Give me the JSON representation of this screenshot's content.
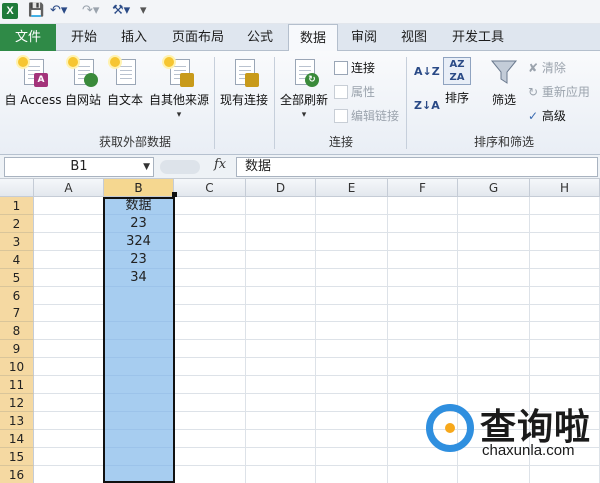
{
  "qat": {
    "app_icon": "X",
    "save_icon": "save-icon",
    "undo_icon": "undo-icon",
    "redo_icon": "redo-icon",
    "tool_icon": "tool-icon"
  },
  "tabs": [
    {
      "label": "文件"
    },
    {
      "label": "开始"
    },
    {
      "label": "插入"
    },
    {
      "label": "页面布局"
    },
    {
      "label": "公式"
    },
    {
      "label": "数据"
    },
    {
      "label": "审阅"
    },
    {
      "label": "视图"
    },
    {
      "label": "开发工具"
    }
  ],
  "ribbon": {
    "external_group": {
      "label": "获取外部数据",
      "buttons": [
        {
          "label": "自 Access",
          "badge": "A",
          "badge_color": "#a3337a"
        },
        {
          "label": "自网站",
          "badge": "",
          "badge_color": "#3a8a3a"
        },
        {
          "label": "自文本",
          "badge": "",
          "badge_color": "#c89a1a"
        },
        {
          "label": "自其他来源",
          "badge": "",
          "badge_color": "#c89a1a"
        },
        {
          "label": "现有连接",
          "badge": "",
          "badge_color": "#c89a1a"
        }
      ]
    },
    "connections_group": {
      "label": "连接",
      "refresh_label": "全部刷新",
      "items": [
        {
          "label": "连接"
        },
        {
          "label": "属性"
        },
        {
          "label": "编辑链接"
        }
      ]
    },
    "sort_group": {
      "label": "排序和筛选",
      "sort_az_label": "A↓Z",
      "sort_za_label": "Z↓A",
      "sort_label": "排序",
      "filter_label": "筛选",
      "items": [
        {
          "label": "清除"
        },
        {
          "label": "重新应用"
        },
        {
          "label": "高级"
        }
      ]
    }
  },
  "formula_bar": {
    "name_box": "B1",
    "fx": "fx",
    "content": "数据"
  },
  "sheet": {
    "columns": [
      "A",
      "B",
      "C",
      "D",
      "E",
      "F",
      "G",
      "H"
    ],
    "rows": [
      "1",
      "2",
      "3",
      "4",
      "5",
      "6",
      "7",
      "8",
      "9",
      "10",
      "11",
      "12",
      "13",
      "14",
      "15",
      "16"
    ],
    "column_b": [
      "数据",
      "23",
      "324",
      "23",
      "34",
      "",
      "",
      "",
      "",
      "",
      "",
      "",
      "",
      "",
      "",
      ""
    ]
  },
  "watermark": {
    "brand": "查询啦",
    "url": "chaxunla.com"
  }
}
